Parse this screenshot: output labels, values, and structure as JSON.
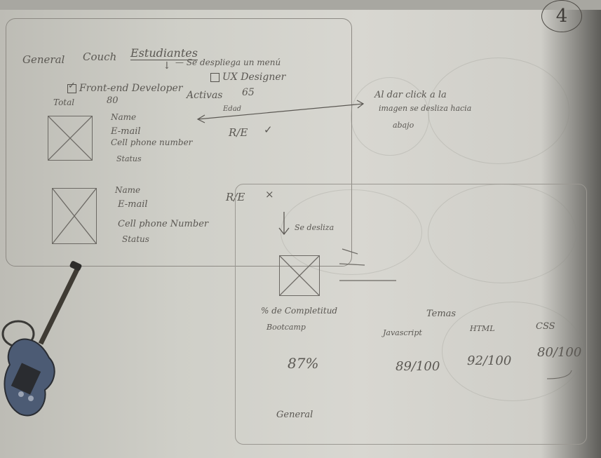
{
  "page_number": "4",
  "tabs": {
    "general": "General",
    "couch": "Couch",
    "estudiantes": "Estudiantes",
    "dropdown_note": "Se despliega un menú"
  },
  "filters": {
    "frontend_label": "Front-end Developer",
    "frontend_checked": true,
    "ux_label": "UX Designer",
    "ux_checked": false,
    "total_label": "Total",
    "total_value": "80",
    "activas_label": "Activas",
    "activas_value": "65"
  },
  "students": [
    {
      "name": "Name",
      "email": "E-mail",
      "phone": "Cell phone number",
      "status": "Status",
      "edad_label": "Edad",
      "result": "R/E",
      "mark": "✓"
    },
    {
      "name": "Name",
      "email": "E-mail",
      "phone": "Cell phone Number",
      "status": "Status",
      "result": "R/E",
      "mark": "×"
    }
  ],
  "annotation_click": {
    "line1": "Al dar click a la",
    "line2": "imagen se desliza hacia",
    "line3": "abajo"
  },
  "annotation_slide": "Se desliza",
  "detail": {
    "completion_label_line1": "% de Completitud",
    "completion_label_line2": "Bootcamp",
    "completion_value": "87%",
    "temas_label": "Temas",
    "topics": [
      {
        "name": "Javascript",
        "score": "89/100"
      },
      {
        "name": "HTML",
        "score": "92/100"
      },
      {
        "name": "CSS",
        "score": "80/100"
      }
    ],
    "footer": "General"
  },
  "colors": {
    "paper": "#d6d5cf",
    "ink": "#55524d",
    "shadow": "#5e5d59"
  },
  "icons": [
    "image-placeholder-icon",
    "checkbox-icon",
    "down-arrow-icon",
    "double-arrow-icon",
    "guitar-icon"
  ]
}
